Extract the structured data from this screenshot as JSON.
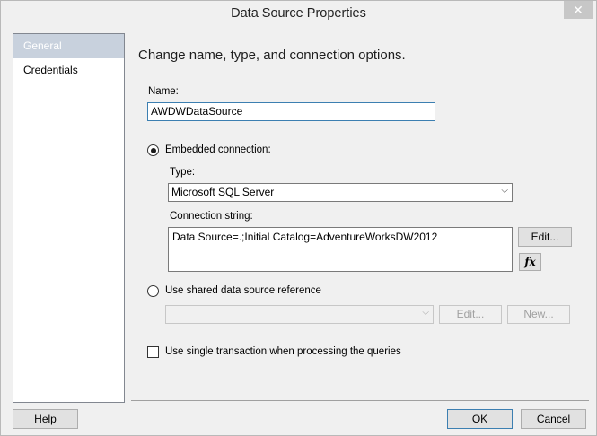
{
  "window": {
    "title": "Data Source Properties",
    "close_glyph": "✕"
  },
  "nav": {
    "items": [
      {
        "label": "General",
        "selected": true
      },
      {
        "label": "Credentials",
        "selected": false
      }
    ]
  },
  "general": {
    "heading": "Change name, type, and connection options.",
    "name_label": "Name:",
    "name_value": "AWDWDataSource",
    "embedded_label": "Embedded connection:",
    "type_label": "Type:",
    "type_value": "Microsoft SQL Server",
    "connection_label": "Connection string:",
    "connection_value": "Data Source=.;Initial Catalog=AdventureWorksDW2012",
    "edit_label": "Edit...",
    "fx_label": "fx",
    "shared_label": "Use shared data source reference",
    "shared_value": "",
    "shared_edit_label": "Edit...",
    "shared_new_label": "New...",
    "single_transaction_label": "Use single transaction when processing the queries"
  },
  "footer": {
    "help_label": "Help",
    "ok_label": "OK",
    "cancel_label": "Cancel"
  }
}
